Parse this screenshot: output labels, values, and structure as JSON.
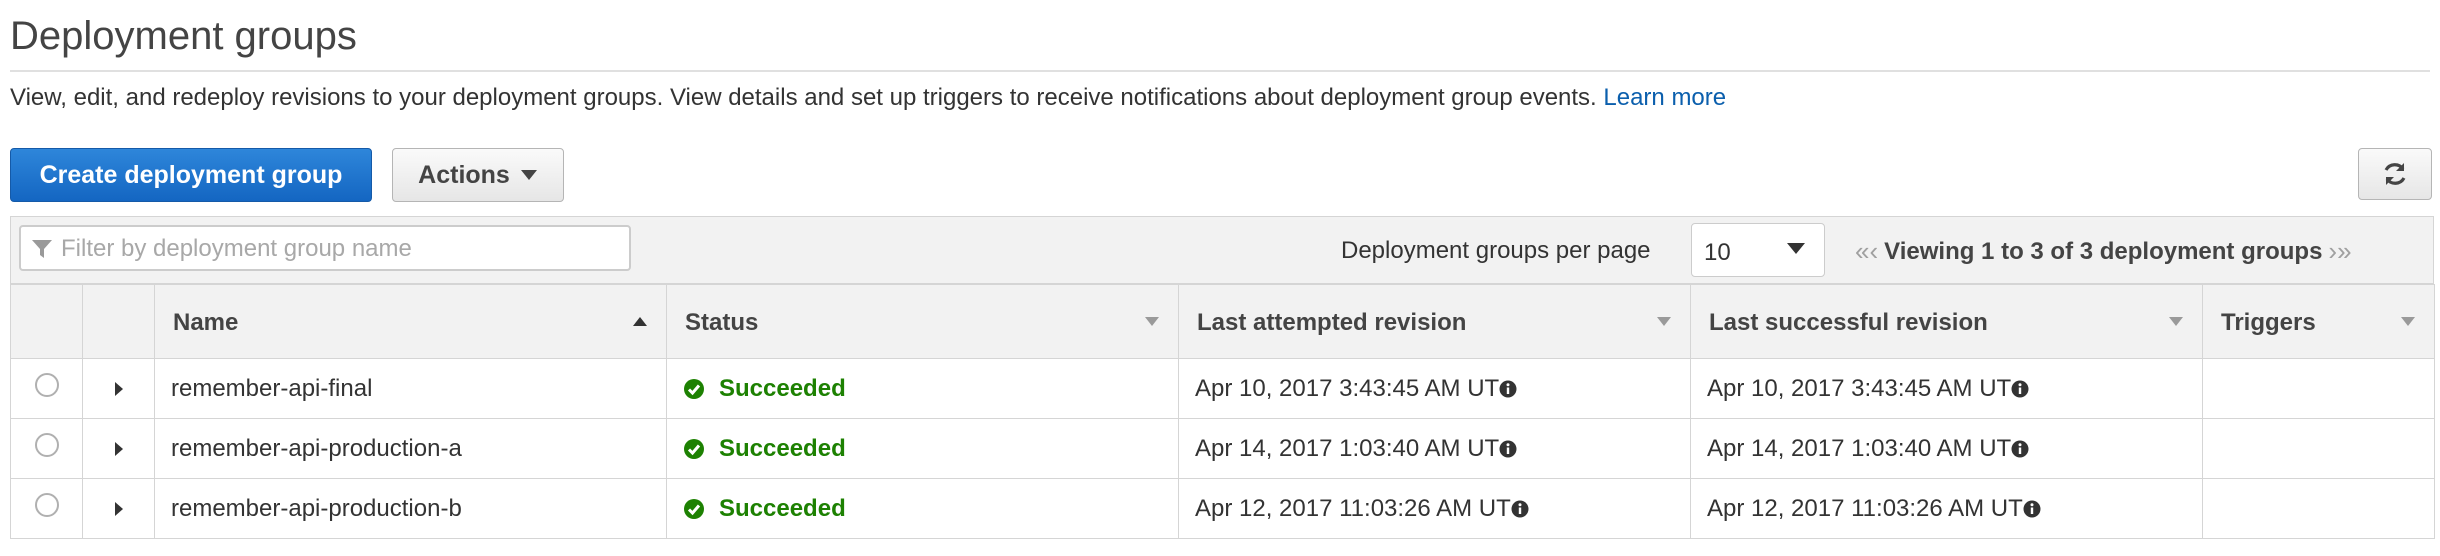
{
  "page": {
    "title": "Deployment groups",
    "description": "View, edit, and redeploy revisions to your deployment groups. View details and set up triggers to receive notifications about deployment group events.",
    "learn_more": "Learn more"
  },
  "toolbar": {
    "create_label": "Create deployment group",
    "actions_label": "Actions",
    "refresh_icon": "refresh-icon"
  },
  "filter": {
    "placeholder": "Filter by deployment group name",
    "value": ""
  },
  "pagination": {
    "per_page_label": "Deployment groups per page",
    "per_page_value": "10",
    "viewing_text": "Viewing 1 to 3 of 3 deployment groups"
  },
  "table": {
    "columns": {
      "name": "Name",
      "status": "Status",
      "last_attempted": "Last attempted revision",
      "last_successful": "Last successful revision",
      "triggers": "Triggers"
    },
    "rows": [
      {
        "name": "remember-api-final",
        "status": "Succeeded",
        "last_attempted": "Apr 10, 2017 3:43:45 AM UT",
        "last_successful": "Apr 10, 2017 3:43:45 AM UT",
        "triggers": ""
      },
      {
        "name": "remember-api-production-a",
        "status": "Succeeded",
        "last_attempted": "Apr 14, 2017 1:03:40 AM UT",
        "last_successful": "Apr 14, 2017 1:03:40 AM UT",
        "triggers": ""
      },
      {
        "name": "remember-api-production-b",
        "status": "Succeeded",
        "last_attempted": "Apr 12, 2017 11:03:26 AM UT",
        "last_successful": "Apr 12, 2017 11:03:26 AM UT",
        "triggers": ""
      }
    ]
  },
  "colors": {
    "primary": "#1466c2",
    "success": "#1d8102",
    "link": "#0b5fad"
  }
}
